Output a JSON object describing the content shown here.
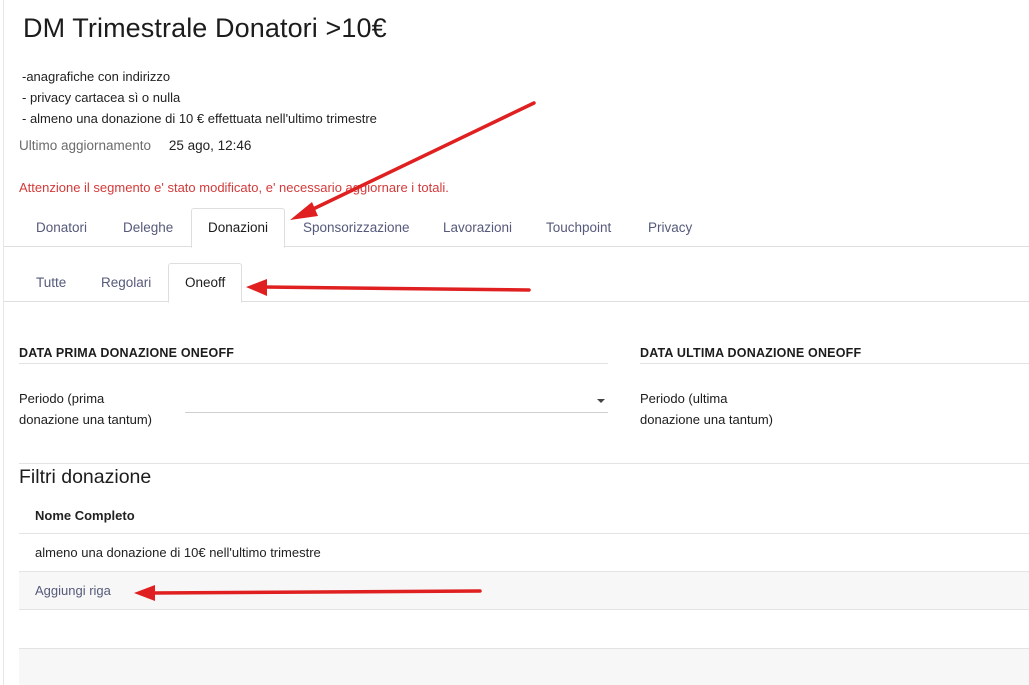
{
  "page": {
    "title": "DM Trimestrale Donatori >10€",
    "description": [
      "-anagrafiche con indirizzo",
      "- privacy cartacea sì o nulla",
      "- almeno una donazione di 10 € effettuata nell'ultimo trimestre"
    ],
    "last_update_label": "Ultimo aggiornamento",
    "last_update_value": "25 ago, 12:46",
    "warning": "Attenzione il segmento e' stato modificato, e' necessario aggiornare i totali."
  },
  "main_tabs": [
    {
      "label": "Donatori",
      "active": false
    },
    {
      "label": "Deleghe",
      "active": false
    },
    {
      "label": "Donazioni",
      "active": true
    },
    {
      "label": "Sponsorizzazione",
      "active": false
    },
    {
      "label": "Lavorazioni",
      "active": false
    },
    {
      "label": "Touchpoint",
      "active": false
    },
    {
      "label": "Privacy",
      "active": false
    }
  ],
  "sub_tabs": [
    {
      "label": "Tutte",
      "active": false
    },
    {
      "label": "Regolari",
      "active": false
    },
    {
      "label": "Oneoff",
      "active": true
    }
  ],
  "first_donation": {
    "heading": "DATA PRIMA DONAZIONE ONEOFF",
    "field_label_line1": "Periodo (prima",
    "field_label_line2": "donazione una tantum)",
    "value": ""
  },
  "last_donation": {
    "heading": "DATA ULTIMA DONAZIONE ONEOFF",
    "field_label_line1": "Periodo (ultima",
    "field_label_line2": "donazione una tantum)"
  },
  "filters": {
    "title": "Filtri donazione",
    "column_header": "Nome Completo",
    "rows": [
      "almeno una donazione di 10€ nell'ultimo trimestre"
    ],
    "add_row_label": "Aggiungi riga"
  },
  "colors": {
    "warning": "#d33a3a",
    "annotation_arrow": "#e02020",
    "tab_text": "#555a7a"
  }
}
